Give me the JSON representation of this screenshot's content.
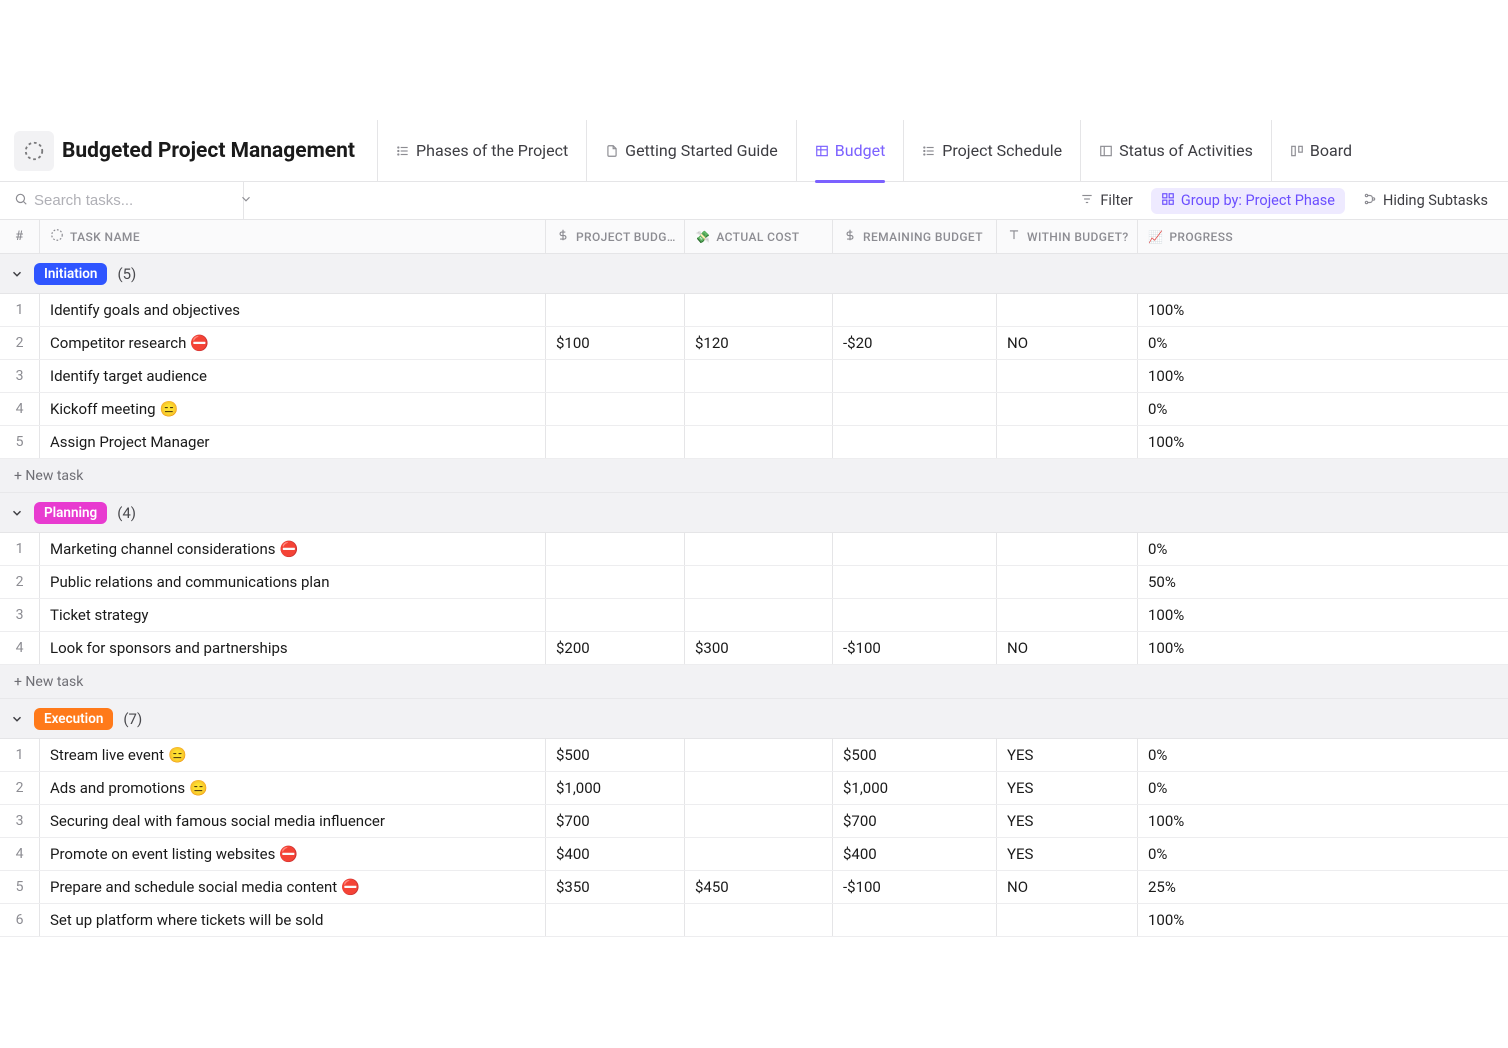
{
  "page_title": "Budgeted Project Management",
  "tabs": [
    {
      "label": "Phases of the Project",
      "icon": "list"
    },
    {
      "label": "Getting Started Guide",
      "icon": "doc"
    },
    {
      "label": "Budget",
      "icon": "table",
      "active": true
    },
    {
      "label": "Project Schedule",
      "icon": "list"
    },
    {
      "label": "Status of Activities",
      "icon": "panel"
    },
    {
      "label": "Board",
      "icon": "board"
    }
  ],
  "search_placeholder": "Search tasks...",
  "toolbar": {
    "filter": "Filter",
    "group_by": "Group by: Project Phase",
    "hiding": "Hiding Subtasks"
  },
  "columns": {
    "num": "#",
    "name": "TASK NAME",
    "budget": "PROJECT BUDG…",
    "actual": "ACTUAL COST",
    "remaining": "REMAINING BUDGET",
    "within": "WITHIN BUDGET?",
    "progress": "PROGRESS"
  },
  "column_emojis": {
    "actual": "💸",
    "progress": "📈"
  },
  "new_task_label": "+ New task",
  "groups": [
    {
      "name": "Initiation",
      "color": "#2f55ff",
      "count": "(5)",
      "rows": [
        {
          "n": "1",
          "name": "Identify goals and objectives",
          "emoji": "",
          "budget": "",
          "actual": "",
          "remaining": "",
          "within": "",
          "progress": "100%"
        },
        {
          "n": "2",
          "name": "Competitor research",
          "emoji": "⛔",
          "budget": "$100",
          "actual": "$120",
          "remaining": "-$20",
          "within": "NO",
          "progress": "0%"
        },
        {
          "n": "3",
          "name": "Identify target audience",
          "emoji": "",
          "budget": "",
          "actual": "",
          "remaining": "",
          "within": "",
          "progress": "100%"
        },
        {
          "n": "4",
          "name": "Kickoff meeting",
          "emoji": "😑",
          "budget": "",
          "actual": "",
          "remaining": "",
          "within": "",
          "progress": "0%"
        },
        {
          "n": "5",
          "name": "Assign Project Manager",
          "emoji": "",
          "budget": "",
          "actual": "",
          "remaining": "",
          "within": "",
          "progress": "100%"
        }
      ]
    },
    {
      "name": "Planning",
      "color": "#e83bd0",
      "count": "(4)",
      "rows": [
        {
          "n": "1",
          "name": "Marketing channel considerations",
          "emoji": "⛔",
          "budget": "",
          "actual": "",
          "remaining": "",
          "within": "",
          "progress": "0%"
        },
        {
          "n": "2",
          "name": "Public relations and communications plan",
          "emoji": "",
          "budget": "",
          "actual": "",
          "remaining": "",
          "within": "",
          "progress": "50%"
        },
        {
          "n": "3",
          "name": "Ticket strategy",
          "emoji": "",
          "budget": "",
          "actual": "",
          "remaining": "",
          "within": "",
          "progress": "100%"
        },
        {
          "n": "4",
          "name": "Look for sponsors and partnerships",
          "emoji": "",
          "budget": "$200",
          "actual": "$300",
          "remaining": "-$100",
          "within": "NO",
          "progress": "100%"
        }
      ]
    },
    {
      "name": "Execution",
      "color": "#ff7a1a",
      "count": "(7)",
      "rows": [
        {
          "n": "1",
          "name": "Stream live event",
          "emoji": "😑",
          "budget": "$500",
          "actual": "",
          "remaining": "$500",
          "within": "YES",
          "progress": "0%"
        },
        {
          "n": "2",
          "name": "Ads and promotions",
          "emoji": "😑",
          "budget": "$1,000",
          "actual": "",
          "remaining": "$1,000",
          "within": "YES",
          "progress": "0%"
        },
        {
          "n": "3",
          "name": "Securing deal with famous social media influencer",
          "emoji": "",
          "budget": "$700",
          "actual": "",
          "remaining": "$700",
          "within": "YES",
          "progress": "100%"
        },
        {
          "n": "4",
          "name": "Promote on event listing websites",
          "emoji": "⛔",
          "budget": "$400",
          "actual": "",
          "remaining": "$400",
          "within": "YES",
          "progress": "0%"
        },
        {
          "n": "5",
          "name": "Prepare and schedule social media content",
          "emoji": "⛔",
          "budget": "$350",
          "actual": "$450",
          "remaining": "-$100",
          "within": "NO",
          "progress": "25%"
        },
        {
          "n": "6",
          "name": "Set up platform where tickets will be sold",
          "emoji": "",
          "budget": "",
          "actual": "",
          "remaining": "",
          "within": "",
          "progress": "100%"
        }
      ]
    }
  ]
}
